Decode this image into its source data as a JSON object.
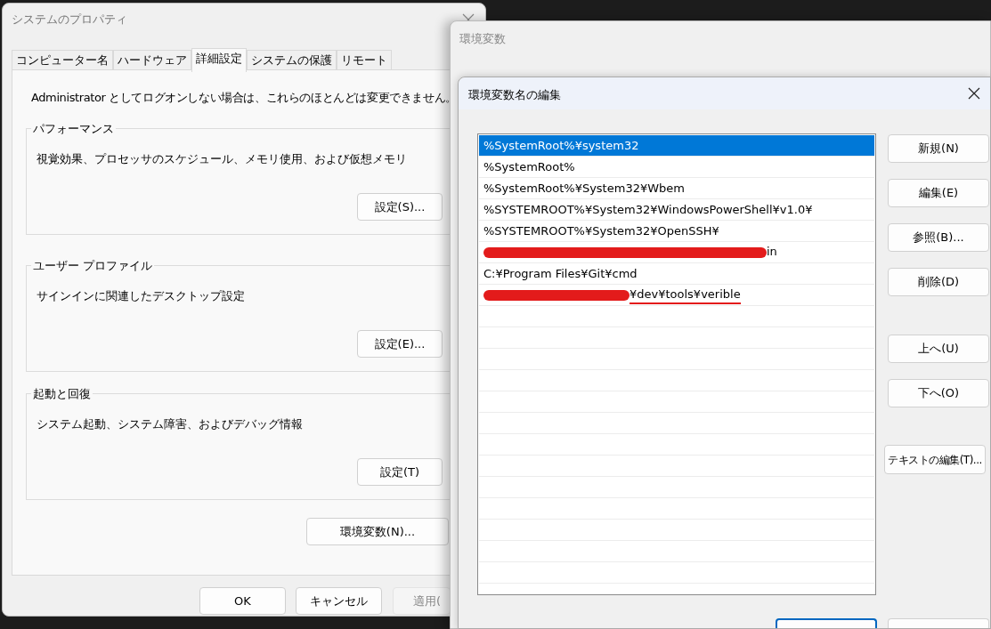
{
  "system_properties": {
    "title": "システムのプロパティ",
    "tabs": [
      {
        "label": "コンピューター名",
        "selected": false
      },
      {
        "label": "ハードウェア",
        "selected": false
      },
      {
        "label": "詳細設定",
        "selected": true
      },
      {
        "label": "システムの保護",
        "selected": false
      },
      {
        "label": "リモート",
        "selected": false
      }
    ],
    "notice": "Administrator としてログオンしない場合は、これらのほとんどは変更できません。",
    "groups": [
      {
        "title": "パフォーマンス",
        "description": "視覚効果、プロセッサのスケジュール、メモリ使用、および仮想メモリ",
        "button": "設定(S)..."
      },
      {
        "title": "ユーザー プロファイル",
        "description": "サインインに関連したデスクトップ設定",
        "button": "設定(E)..."
      },
      {
        "title": "起動と回復",
        "description": "システム起動、システム障害、およびデバッグ情報",
        "button": "設定(T)"
      }
    ],
    "env_button": "環境変数(N)...",
    "buttons": [
      {
        "label": "OK",
        "disabled": false
      },
      {
        "label": "キャンセル",
        "disabled": false
      },
      {
        "label": "適用(",
        "disabled": true
      }
    ]
  },
  "environment_variables": {
    "title": "環境変数"
  },
  "edit_dialog": {
    "title": "環境変数名の編集",
    "rows": [
      {
        "kind": "text",
        "text": "%SystemRoot%¥system32",
        "selected": true
      },
      {
        "kind": "text",
        "text": "%SystemRoot%",
        "selected": false
      },
      {
        "kind": "text",
        "text": "%SystemRoot%¥System32¥Wbem",
        "selected": false
      },
      {
        "kind": "text",
        "text": "%SYSTEMROOT%¥System32¥WindowsPowerShell¥v1.0¥",
        "selected": false
      },
      {
        "kind": "text",
        "text": "%SYSTEMROOT%¥System32¥OpenSSH¥",
        "selected": false
      },
      {
        "kind": "redacted",
        "text": "in",
        "underlined": false,
        "selected": false
      },
      {
        "kind": "text",
        "text": "C:¥Program Files¥Git¥cmd",
        "selected": false
      },
      {
        "kind": "redacted",
        "text": "¥dev¥tools¥verible",
        "underlined": true,
        "selected": false
      }
    ],
    "buttons": [
      "新規(N)",
      "編集(E)",
      "参照(B)...",
      "削除(D)"
    ],
    "move_buttons": [
      "上へ(U)",
      "下へ(O)"
    ],
    "text_edit_button": "テキストの編集(T)..."
  }
}
